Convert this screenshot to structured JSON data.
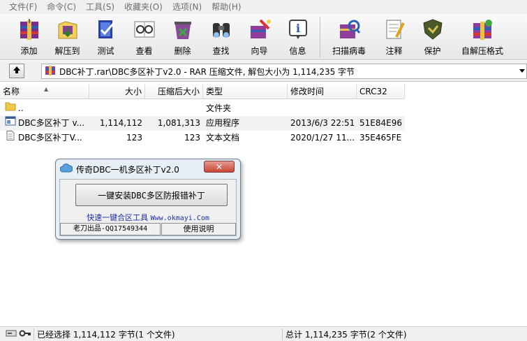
{
  "menu": [
    "文件(F)",
    "命令(C)",
    "工具(S)",
    "收藏夹(O)",
    "选项(N)",
    "帮助(H)"
  ],
  "toolbar": [
    {
      "label": "添加",
      "icon": "add-archive-icon"
    },
    {
      "label": "解压到",
      "icon": "extract-to-icon"
    },
    {
      "label": "测试",
      "icon": "test-icon"
    },
    {
      "label": "查看",
      "icon": "view-icon"
    },
    {
      "label": "删除",
      "icon": "delete-icon"
    },
    {
      "label": "查找",
      "icon": "find-icon"
    },
    {
      "label": "向导",
      "icon": "wizard-icon"
    },
    {
      "label": "信息",
      "icon": "info-icon"
    },
    {
      "label": "扫描病毒",
      "icon": "virus-scan-icon"
    },
    {
      "label": "注释",
      "icon": "comment-icon"
    },
    {
      "label": "保护",
      "icon": "protect-icon"
    },
    {
      "label": "自解压格式",
      "icon": "sfx-icon"
    }
  ],
  "address": {
    "path": "DBC补丁.rar\\DBC多区补丁v2.0 - RAR 压缩文件, 解包大小为 1,114,235 字节"
  },
  "columns": {
    "name": "名称",
    "size": "大小",
    "packed": "压缩后大小",
    "type": "类型",
    "modified": "修改时间",
    "crc": "CRC32"
  },
  "files": [
    {
      "name": "..",
      "size": "",
      "packed": "",
      "type": "文件夹",
      "modified": "",
      "crc": "",
      "icon": "folder-icon"
    },
    {
      "name": "DBC多区补丁 v...",
      "size": "1,114,112",
      "packed": "1,081,313",
      "type": "应用程序",
      "modified": "2013/6/3 22:51",
      "crc": "51E84E96",
      "icon": "exe-icon"
    },
    {
      "name": "DBC多区补丁V...",
      "size": "123",
      "packed": "123",
      "type": "文本文档",
      "modified": "2020/1/27 11...",
      "crc": "35E465FE",
      "icon": "text-file-icon"
    }
  ],
  "dialog": {
    "title": "传奇DBC一机多区补丁v2.0",
    "close": "✕",
    "main_button": "一键安装DBC多区防报错补丁",
    "link_prefix": "快速一键合区工具 ",
    "link_url": "Www.okmayi.Com",
    "status_left": "老刀出品-QQ17549344",
    "status_right": "使用说明"
  },
  "status": {
    "left": "已经选择 1,114,112 字节(1 个文件)",
    "right": "总计 1,114,235 字节(2 个文件)"
  }
}
